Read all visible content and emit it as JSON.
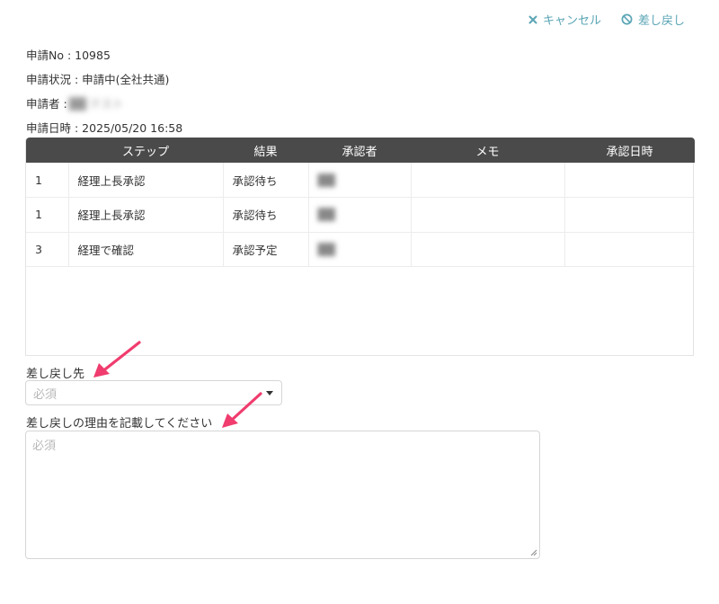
{
  "actions": {
    "cancel_label": "キャンセル",
    "sendback_label": "差し戻し"
  },
  "info": {
    "request_no": "申請No : 10985",
    "status": "申請状況 : 申請中(全社共通)",
    "applicant_label": "申請者 :",
    "applicant_value": "██ テスト",
    "datetime": "申請日時 : 2025/05/20 16:58"
  },
  "table": {
    "headers": [
      "",
      "ステップ",
      "結果",
      "承認者",
      "メモ",
      "承認日時"
    ],
    "rows": [
      {
        "num": "1",
        "step": "経理上長承認",
        "result": "承認待ち",
        "approver": "██",
        "memo": "",
        "date": ""
      },
      {
        "num": "1",
        "step": "経理上長承認",
        "result": "承認待ち",
        "approver": "██",
        "memo": "",
        "date": ""
      },
      {
        "num": "3",
        "step": "経理で確認",
        "result": "承認予定",
        "approver": "██",
        "memo": "",
        "date": ""
      }
    ]
  },
  "form": {
    "target_label": "差し戻し先",
    "target_placeholder": "必須",
    "reason_label": "差し戻しの理由を記載してください",
    "reason_placeholder": "必須"
  },
  "colors": {
    "accent": "#5aa5b5",
    "header_bg": "#4a4a4a",
    "arrow": "#f03c6e"
  }
}
